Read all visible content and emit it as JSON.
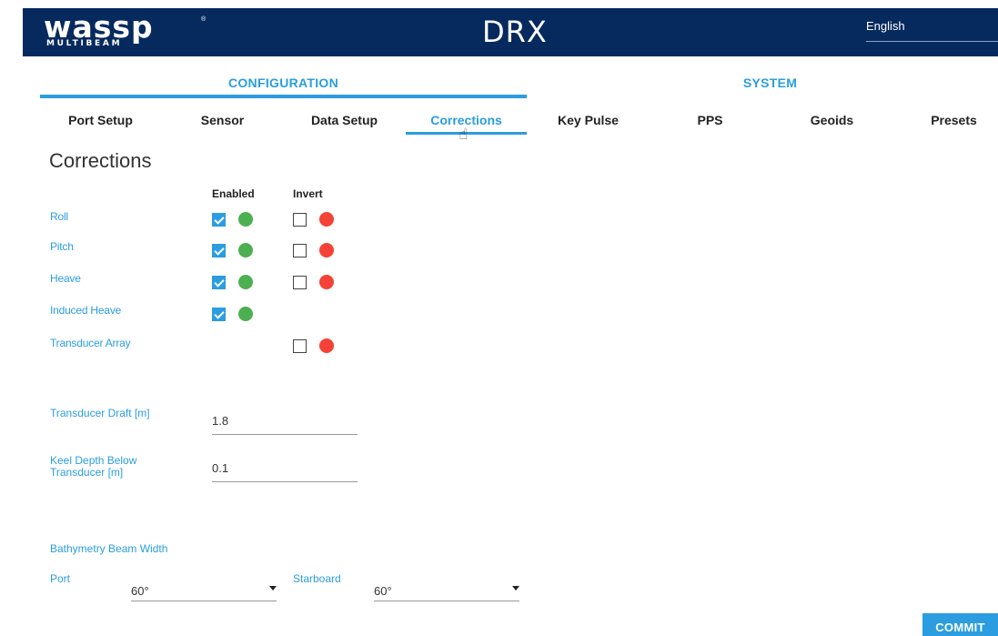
{
  "header": {
    "logo_text": "wassp",
    "logo_sub": "MULTIBEAM",
    "app_title": "DRX",
    "language": "English"
  },
  "top_tabs": [
    {
      "label": "CONFIGURATION",
      "active": true
    },
    {
      "label": "SYSTEM",
      "active": false
    }
  ],
  "sub_tabs": [
    {
      "label": "Port Setup"
    },
    {
      "label": "Sensor"
    },
    {
      "label": "Data Setup"
    },
    {
      "label": "Corrections",
      "active": true
    },
    {
      "label": "Key Pulse"
    },
    {
      "label": "PPS"
    },
    {
      "label": "Geoids"
    },
    {
      "label": "Presets"
    }
  ],
  "page": {
    "title": "Corrections",
    "columns": {
      "enabled": "Enabled",
      "invert": "Invert"
    },
    "rows": [
      {
        "label": "Roll",
        "enabled": true,
        "invert": false
      },
      {
        "label": "Pitch",
        "enabled": true,
        "invert": false
      },
      {
        "label": "Heave",
        "enabled": true,
        "invert": false
      },
      {
        "label": "Induced Heave",
        "enabled": true
      },
      {
        "label": "Transducer Array",
        "invert": false
      }
    ],
    "transducer_draft": {
      "label": "Transducer Draft [m]",
      "value": "1.8"
    },
    "keel_depth": {
      "label_line1": "Keel Depth Below",
      "label_line2": "Transducer [m]",
      "value": "0.1"
    },
    "beam_width": {
      "label": "Bathymetry Beam Width",
      "port_label": "Port",
      "port_value": "60°",
      "starboard_label": "Starboard",
      "starboard_value": "60°"
    },
    "commit_label": "COMMIT"
  },
  "colors": {
    "header_bg": "#062a5e",
    "accent": "#2b9de0",
    "status_on": "#4caf50",
    "status_off": "#f44336"
  }
}
